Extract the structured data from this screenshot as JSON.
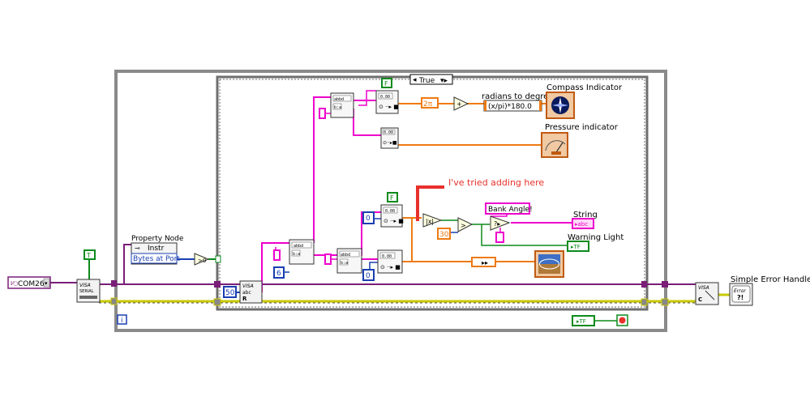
{
  "diagram": {
    "com_port": "COM26",
    "loop_stop_constant": "T",
    "case_selector": "True",
    "case_frame_constant": "F",
    "case_frame_constant_2": "F",
    "visa_serial_label": "VISA",
    "visa_serial_sub": "SERIAL",
    "property_node": {
      "title": "Property Node",
      "row1": "Instr",
      "row2": "Bytes at Port"
    },
    "visa_read_label": "VISA",
    "visa_read_sub": "abc",
    "visa_read_r": "R",
    "constants": {
      "bytes_to_read": "50",
      "six": "6",
      "zero_a": "0",
      "zero_b": "0",
      "two_pi": "2π",
      "thirty": "30",
      "tf_a": "TF",
      "tf_b": "TF",
      "scan_fmt": "abbd",
      "scan_fmt_sub": "b:a",
      "loop_index": "i"
    },
    "formula_node": "(x/pi)*180.0",
    "labels": {
      "radians_to_degrees": "radians to degrees",
      "compass_indicator": "Compass Indicator",
      "pressure_indicator": "Pressure indicator",
      "bank_angle": "Bank Angle!",
      "string": "String",
      "string_terminal": "abc",
      "warning_light": "Warning Light",
      "simple_error_handler": "Simple Error Handler.vi",
      "visa_close_label": "VISA",
      "visa_close_sub": "C",
      "error_label": "Error",
      "annotation": "I've tried adding here"
    },
    "colors": {
      "boolean_green": "#0c8a1c",
      "integer_blue": "#1a3fb2",
      "float_orange": "#ee7a12",
      "string_pink": "#ee00cc",
      "visa_purple": "#7a1e78",
      "error_yellow": "#c8c800",
      "frame_gray": "#7a7a7a",
      "annotation_red": "#e8302c"
    }
  }
}
